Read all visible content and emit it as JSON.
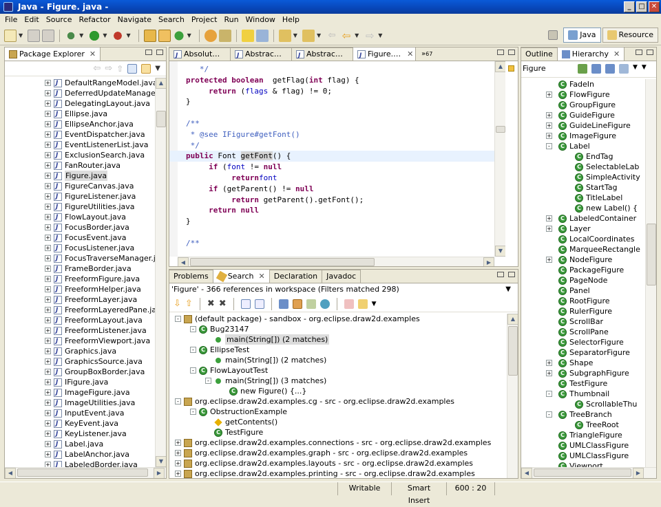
{
  "window": {
    "title": "Java - Figure. java -"
  },
  "menu": [
    "File",
    "Edit",
    "Source",
    "Refactor",
    "Navigate",
    "Search",
    "Project",
    "Run",
    "Window",
    "Help"
  ],
  "perspectives": [
    {
      "label": "Java",
      "active": true
    },
    {
      "label": "Resource",
      "active": false
    }
  ],
  "package_explorer": {
    "tab": "Package Explorer",
    "items": [
      "DefaultRangeModel.java",
      "DeferredUpdateManager.java",
      "DelegatingLayout.java",
      "Ellipse.java",
      "EllipseAnchor.java",
      "EventDispatcher.java",
      "EventListenerList.java",
      "ExclusionSearch.java",
      "FanRouter.java",
      "Figure.java",
      "FigureCanvas.java",
      "FigureListener.java",
      "FigureUtilities.java",
      "FlowLayout.java",
      "FocusBorder.java",
      "FocusEvent.java",
      "FocusListener.java",
      "FocusTraverseManager.java",
      "FrameBorder.java",
      "FreeformFigure.java",
      "FreeformHelper.java",
      "FreeformLayer.java",
      "FreeformLayeredPane.java",
      "FreeformLayout.java",
      "FreeformListener.java",
      "FreeformViewport.java",
      "Graphics.java",
      "GraphicsSource.java",
      "GroupBoxBorder.java",
      "IFigure.java",
      "ImageFigure.java",
      "ImageUtilities.java",
      "InputEvent.java",
      "KeyEvent.java",
      "KeyListener.java",
      "Label.java",
      "LabelAnchor.java",
      "LabeledBorder.java"
    ],
    "selected": "Figure.java"
  },
  "editor": {
    "tabs": [
      "Absolut…",
      "Abstrac…",
      "Abstrac…",
      "Figure.…"
    ],
    "active_tab": "Figure.…",
    "overflow_count": "67",
    "lines": [
      [
        [
          "cm",
          "   */"
        ]
      ],
      [
        [
          "kw",
          "protected boolean"
        ],
        [
          "",
          "  getFlag("
        ],
        [
          "kw",
          "int"
        ],
        [
          "",
          " flag) {"
        ]
      ],
      [
        [
          "",
          "     "
        ],
        [
          "kw",
          "return"
        ],
        [
          "",
          " ("
        ],
        [
          "fld",
          "flags"
        ],
        [
          "",
          " & flag) != 0;"
        ]
      ],
      [
        [
          "",
          "}"
        ]
      ],
      [
        [
          "",
          ""
        ]
      ],
      [
        [
          "cm",
          "/**"
        ]
      ],
      [
        [
          "cm",
          " * @see IFigure#getFont()"
        ]
      ],
      [
        [
          "cm",
          " */"
        ]
      ],
      [
        [
          "kw",
          "public"
        ],
        [
          "",
          " Font "
        ],
        [
          "occ",
          "getFont"
        ],
        [
          "",
          "() {"
        ]
      ],
      [
        [
          "",
          "     "
        ],
        [
          "kw",
          "if"
        ],
        [
          "",
          " ("
        ],
        [
          "fld",
          "font"
        ],
        [
          "",
          " != "
        ],
        [
          "kw",
          "null"
        ],
        [
          ")"
        ]
      ],
      [
        [
          "",
          "          "
        ],
        [
          "kw",
          "return"
        ],
        [
          " "
        ],
        [
          "fld",
          "font"
        ],
        [
          ";"
        ]
      ],
      [
        [
          "",
          "     "
        ],
        [
          "kw",
          "if"
        ],
        [
          "",
          " (getParent() != "
        ],
        [
          "kw",
          "null"
        ],
        [
          ")"
        ]
      ],
      [
        [
          "",
          "          "
        ],
        [
          "kw",
          "return"
        ],
        [
          "",
          " getParent().getFont();"
        ]
      ],
      [
        [
          "",
          "     "
        ],
        [
          "kw",
          "return null"
        ],
        [
          ";"
        ]
      ],
      [
        [
          "",
          "}"
        ]
      ],
      [
        [
          "",
          ""
        ]
      ],
      [
        [
          "cm",
          "/**"
        ]
      ]
    ]
  },
  "outline": {
    "tabs": [
      "Outline",
      "Hierarchy"
    ],
    "title": "Figure",
    "items": [
      {
        "label": "FadeIn",
        "indent": 0,
        "exp": false
      },
      {
        "label": "FlowFigure",
        "indent": 0,
        "exp": true
      },
      {
        "label": "GroupFigure",
        "indent": 0,
        "exp": false
      },
      {
        "label": "GuideFigure",
        "indent": 0,
        "exp": true
      },
      {
        "label": "GuideLineFigure",
        "indent": 0,
        "exp": true
      },
      {
        "label": "ImageFigure",
        "indent": 0,
        "exp": true
      },
      {
        "label": "Label",
        "indent": 0,
        "exp": true,
        "open": true
      },
      {
        "label": "EndTag",
        "indent": 1,
        "exp": false
      },
      {
        "label": "SelectableLab",
        "indent": 1,
        "exp": false
      },
      {
        "label": "SimpleActivity",
        "indent": 1,
        "exp": false
      },
      {
        "label": "StartTag",
        "indent": 1,
        "exp": false
      },
      {
        "label": "TitleLabel",
        "indent": 1,
        "exp": false
      },
      {
        "label": "new Label() {",
        "indent": 1,
        "exp": false
      },
      {
        "label": "LabeledContainer",
        "indent": 0,
        "exp": true
      },
      {
        "label": "Layer",
        "indent": 0,
        "exp": true
      },
      {
        "label": "LocalCoordinates",
        "indent": 0,
        "exp": false
      },
      {
        "label": "MarqueeRectangle",
        "indent": 0,
        "exp": false
      },
      {
        "label": "NodeFigure",
        "indent": 0,
        "exp": true
      },
      {
        "label": "PackageFigure",
        "indent": 0,
        "exp": false
      },
      {
        "label": "PageNode",
        "indent": 0,
        "exp": false
      },
      {
        "label": "Panel",
        "indent": 0,
        "exp": false
      },
      {
        "label": "RootFigure",
        "indent": 0,
        "exp": false
      },
      {
        "label": "RulerFigure",
        "indent": 0,
        "exp": false
      },
      {
        "label": "ScrollBar",
        "indent": 0,
        "exp": false
      },
      {
        "label": "ScrollPane",
        "indent": 0,
        "exp": false
      },
      {
        "label": "SelectorFigure",
        "indent": 0,
        "exp": false
      },
      {
        "label": "SeparatorFigure",
        "indent": 0,
        "exp": false
      },
      {
        "label": "Shape",
        "indent": 0,
        "exp": true
      },
      {
        "label": "SubgraphFigure",
        "indent": 0,
        "exp": true
      },
      {
        "label": "TestFigure",
        "indent": 0,
        "exp": false
      },
      {
        "label": "Thumbnail",
        "indent": 0,
        "exp": true,
        "open": true
      },
      {
        "label": "ScrollableThu",
        "indent": 1,
        "exp": false
      },
      {
        "label": "TreeBranch",
        "indent": 0,
        "exp": true,
        "open": true
      },
      {
        "label": "TreeRoot",
        "indent": 1,
        "exp": false
      },
      {
        "label": "TriangleFigure",
        "indent": 0,
        "exp": false
      },
      {
        "label": "UMLClassFigure",
        "indent": 0,
        "exp": false
      },
      {
        "label": "UMLClassFigure",
        "indent": 0,
        "exp": false
      },
      {
        "label": "Viewport",
        "indent": 0,
        "exp": false
      }
    ]
  },
  "bottom": {
    "tabs": [
      "Problems",
      "Search",
      "Declaration",
      "Javadoc"
    ],
    "active_tab": "Search",
    "summary": "'Figure' - 366 references in workspace (Filters matched 298)",
    "results": [
      {
        "label": "(default package) - sandbox - org.eclipse.draw2d.examples",
        "indent": 0,
        "type": "pkg",
        "exp": "-"
      },
      {
        "label": "Bug23147",
        "indent": 1,
        "type": "class",
        "exp": "-"
      },
      {
        "label": "main(String[]) (2 matches)",
        "indent": 2,
        "type": "method",
        "exp": "",
        "sel": true
      },
      {
        "label": "EllipseTest",
        "indent": 1,
        "type": "class",
        "exp": "-"
      },
      {
        "label": "main(String[]) (2 matches)",
        "indent": 2,
        "type": "method",
        "exp": ""
      },
      {
        "label": "FlowLayoutTest",
        "indent": 1,
        "type": "class",
        "exp": "-"
      },
      {
        "label": "main(String[]) (3 matches)",
        "indent": 2,
        "type": "method",
        "exp": "-"
      },
      {
        "label": "new Figure() {...}",
        "indent": 3,
        "type": "anon",
        "exp": ""
      },
      {
        "label": "org.eclipse.draw2d.examples.cg - src - org.eclipse.draw2d.examples",
        "indent": 0,
        "type": "pkg",
        "exp": "-"
      },
      {
        "label": "ObstructionExample",
        "indent": 1,
        "type": "class",
        "exp": "-"
      },
      {
        "label": "getContents()",
        "indent": 2,
        "type": "diamond",
        "exp": ""
      },
      {
        "label": "TestFigure",
        "indent": 2,
        "type": "anon",
        "exp": ""
      },
      {
        "label": "org.eclipse.draw2d.examples.connections - src - org.eclipse.draw2d.examples",
        "indent": 0,
        "type": "pkg",
        "exp": "+"
      },
      {
        "label": "org.eclipse.draw2d.examples.graph - src - org.eclipse.draw2d.examples",
        "indent": 0,
        "type": "pkg",
        "exp": "+"
      },
      {
        "label": "org.eclipse.draw2d.examples.layouts - src - org.eclipse.draw2d.examples",
        "indent": 0,
        "type": "pkg",
        "exp": "+"
      },
      {
        "label": "org.eclipse.draw2d.examples.printing - src - org.eclipse.draw2d.examples",
        "indent": 0,
        "type": "pkg",
        "exp": "+"
      }
    ]
  },
  "status": {
    "writable": "Writable",
    "insert": "Smart Insert",
    "position": "600 : 20"
  }
}
